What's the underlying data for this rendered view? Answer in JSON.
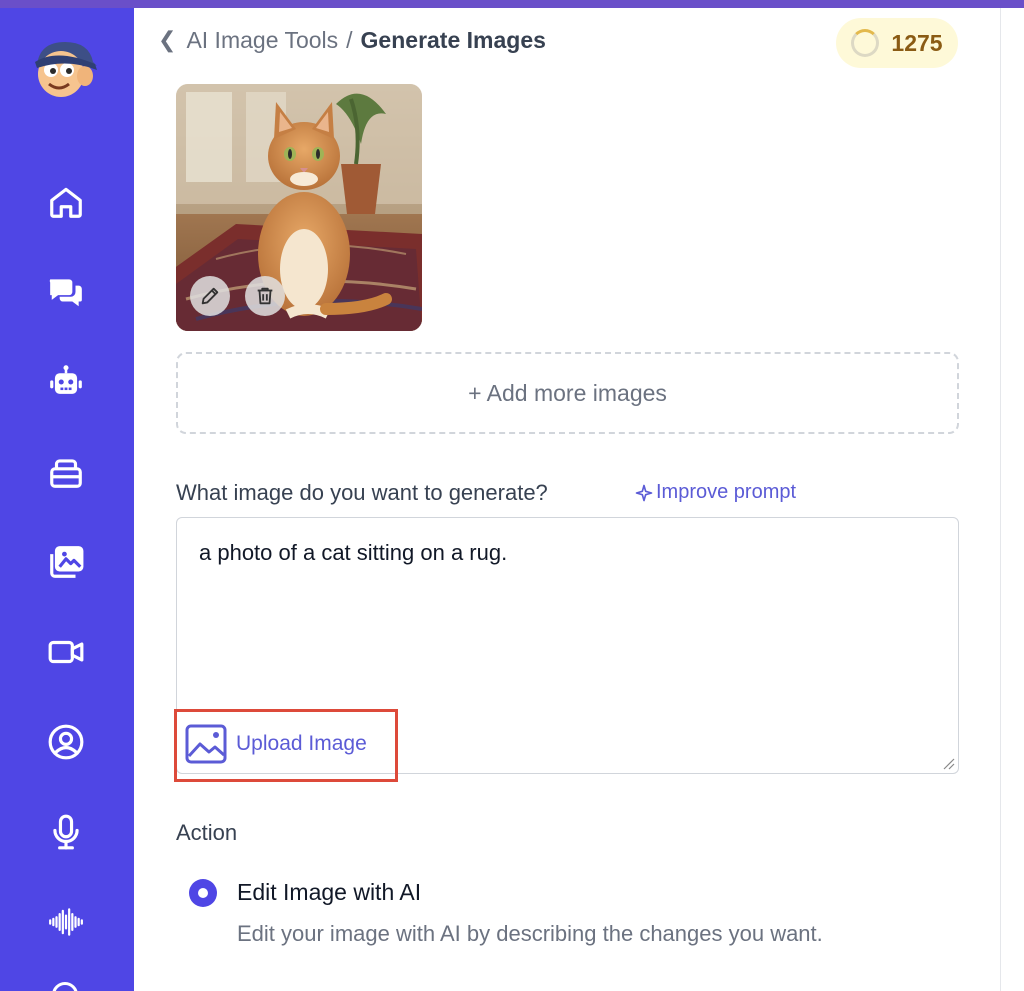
{
  "breadcrumb": {
    "parent": "AI Image Tools",
    "separator": "/",
    "current": "Generate Images"
  },
  "credits": {
    "value": "1275"
  },
  "sidebar": {
    "items": [
      {
        "name": "home",
        "icon": "home-icon"
      },
      {
        "name": "chat",
        "icon": "chat-bubbles-icon"
      },
      {
        "name": "bots",
        "icon": "robot-icon"
      },
      {
        "name": "library",
        "icon": "stack-icon"
      },
      {
        "name": "images",
        "icon": "gallery-icon"
      },
      {
        "name": "video",
        "icon": "video-camera-icon"
      },
      {
        "name": "avatar",
        "icon": "user-circle-icon"
      },
      {
        "name": "voice",
        "icon": "microphone-icon"
      },
      {
        "name": "audio",
        "icon": "waveform-icon"
      }
    ]
  },
  "images": {
    "add_more_label": "+ Add more images"
  },
  "prompt": {
    "label": "What image do you want to generate?",
    "improve_label": "Improve prompt",
    "value": "a photo of a cat sitting on a rug.",
    "upload_label": "Upload Image"
  },
  "action": {
    "title": "Action",
    "option_title": "Edit Image with AI",
    "option_desc": "Edit your image with AI by describing the changes you want."
  },
  "colors": {
    "sidebar": "#4f46e5",
    "accent": "#5b5bd6",
    "highlight": "#dd4a3a",
    "credits_bg": "#fef9d8",
    "credits_text": "#8a5b14"
  }
}
